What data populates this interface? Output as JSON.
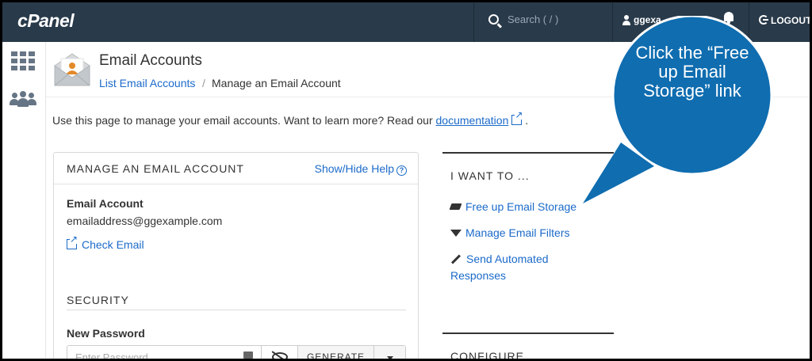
{
  "topbar": {
    "logo": "cPanel",
    "search_placeholder": "Search ( / )",
    "user_name": "ggexa",
    "logout_label": "LOGOUT"
  },
  "header": {
    "title": "Email Accounts",
    "breadcrumb_link": "List Email Accounts",
    "breadcrumb_sep": "/",
    "breadcrumb_current": "Manage an Email Account"
  },
  "intro": {
    "text": "Use this page to manage your email accounts. Want to learn more? Read our ",
    "link": "documentation",
    "end": "."
  },
  "panel": {
    "title": "MANAGE AN EMAIL ACCOUNT",
    "help_link": "Show/Hide Help",
    "account_label": "Email Account",
    "account_value": "emailaddress@ggexample.com",
    "check_email": "Check Email",
    "security_title": "SECURITY",
    "password_label": "New Password",
    "password_placeholder": "Enter Password",
    "generate_label": "GENERATE"
  },
  "actions": {
    "title": "I WANT TO ...",
    "items": [
      "Free up Email Storage",
      "Manage Email Filters",
      "Send Automated Responses"
    ],
    "configure_title": "CONFIGURE"
  },
  "callout": {
    "text": "Click the “Free up Email Storage” link",
    "fill": "#0f6db0"
  },
  "colors": {
    "topbar": "#293a4a",
    "link": "#1b6ac9"
  }
}
